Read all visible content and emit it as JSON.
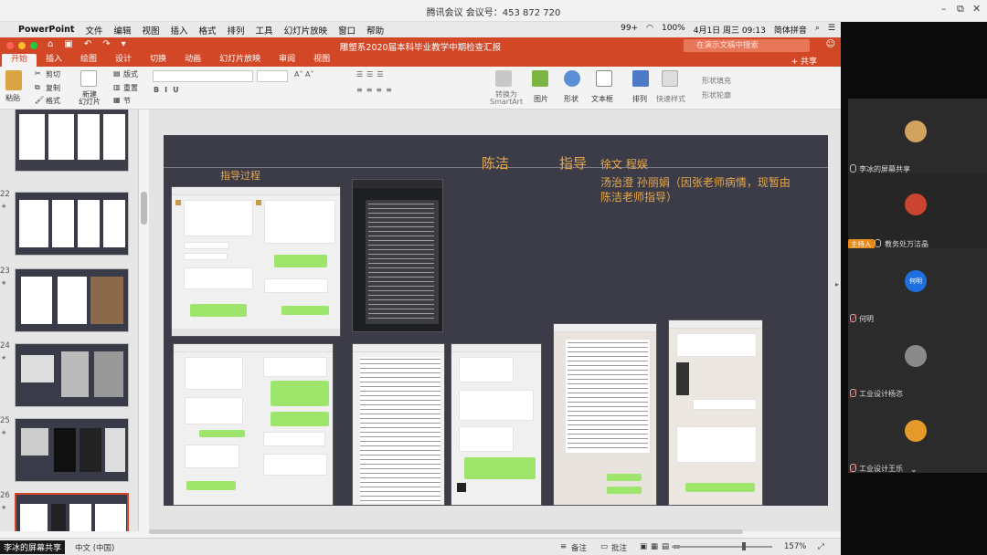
{
  "meeting": {
    "title": "腾讯会议 会议号：453 872 720",
    "win_min": "–",
    "win_restore": "⧉",
    "win_close": "✕"
  },
  "menubar": {
    "app": "PowerPoint",
    "items": [
      "文件",
      "编辑",
      "视图",
      "插入",
      "格式",
      "排列",
      "工具",
      "幻灯片放映",
      "窗口",
      "帮助"
    ],
    "battery": "100%",
    "wifi": "99+",
    "date_time": "4月1日 周三  09:13",
    "input_method": "简体拼音"
  },
  "titlebar": {
    "doc_title": "雕塑系2020届本科毕业教学中期检查汇报",
    "search_placeholder": "在演示文稿中搜索"
  },
  "ribbon_tabs": [
    "开始",
    "插入",
    "绘图",
    "设计",
    "切换",
    "动画",
    "幻灯片放映",
    "审阅",
    "视图"
  ],
  "share_label": "+ 共享",
  "ribbon": {
    "paste": "粘贴",
    "cut": "剪切",
    "copy": "复制",
    "format": "格式",
    "new_slide": "新建\n幻灯片",
    "layout": "版式",
    "reset": "重置",
    "section": "节",
    "convert_smartart": "转换为\nSmartArt",
    "picture": "图片",
    "shape": "形状",
    "textbox": "文本框",
    "arrange": "排列",
    "quick_styles": "快速样式",
    "shape_fill": "形状填充",
    "shape_outline": "形状轮廓"
  },
  "slides": {
    "numbers": [
      "22",
      "23",
      "24",
      "25",
      "26"
    ]
  },
  "slide": {
    "heading_process": "指导过程",
    "heading_teacher": "陈洁",
    "heading_guide": "指导",
    "tutors_line1": "徐文 程娱",
    "tutors_line2": "汤治澄  孙丽娟（因张老师病情，现暂由",
    "tutors_line3": "陈洁老师指导）"
  },
  "statusbar": {
    "sharing": "李冰的屏幕共享",
    "language": "中文 (中国)",
    "notes": "备注",
    "comments": "批注",
    "zoom": "157%"
  },
  "participants": [
    {
      "name": "李冰的屏幕共享",
      "host": false,
      "avatar_color": "#d2a35e"
    },
    {
      "name": "教务处万洁晶",
      "host": true,
      "host_label": "主持人",
      "avatar_color": "#c9452f"
    },
    {
      "name": "何明",
      "host": false,
      "avatar_text": "何明",
      "avatar_color": "#1e6fe0"
    },
    {
      "name": "工业设计杨恣",
      "host": false,
      "avatar_color": "#8a8a8a"
    },
    {
      "name": "工业设计王乐",
      "host": false,
      "avatar_color": "#e69a2a"
    }
  ]
}
